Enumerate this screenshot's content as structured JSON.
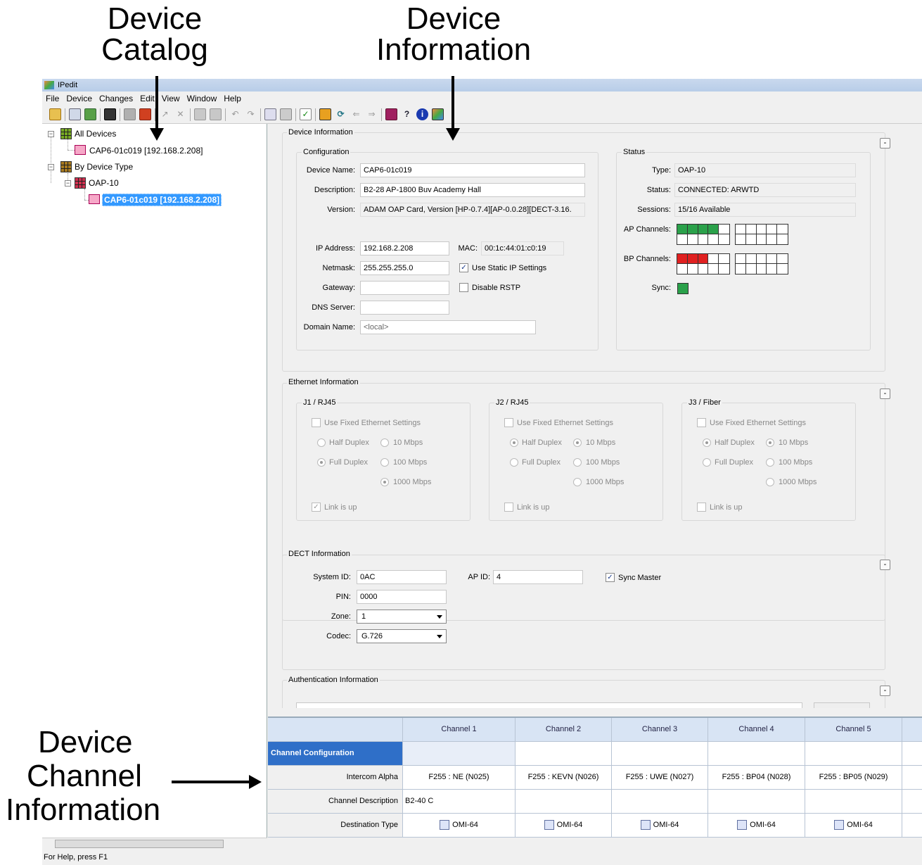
{
  "annotations": {
    "device_catalog": "Device\nCatalog",
    "device_catalog_l1": "Device",
    "device_catalog_l2": "Catalog",
    "device_information_l1": "Device",
    "device_information_l2": "Information",
    "device_channel_l1": "Device",
    "device_channel_l2": "Channel",
    "device_channel_l3": "Information"
  },
  "window": {
    "title": "IPedit"
  },
  "menu": [
    "File",
    "Device",
    "Changes",
    "Edit",
    "View",
    "Window",
    "Help"
  ],
  "tree": {
    "all_devices": "All Devices",
    "all_devices_child": "CAP6-01c019 [192.168.2.208]",
    "by_type": "By Device Type",
    "type_node": "OAP-10",
    "selected": "CAP6-01c019 [192.168.2.208]"
  },
  "device_info": {
    "group_title": "Device Information",
    "configuration": {
      "title": "Configuration",
      "device_name_label": "Device Name:",
      "device_name": "CAP6-01c019",
      "description_label": "Description:",
      "description": "B2-28 AP-1800 Buv Academy Hall",
      "version_label": "Version:",
      "version": "ADAM OAP Card, Version [HP-0.7.4][AP-0.0.28][DECT-3.16.",
      "ip_label": "IP Address:",
      "ip": "192.168.2.208",
      "mac_label": "MAC:",
      "mac": "00:1c:44:01:c0:19",
      "netmask_label": "Netmask:",
      "netmask": "255.255.255.0",
      "use_static_label": "Use Static IP Settings",
      "use_static_checked": true,
      "gateway_label": "Gateway:",
      "gateway": "",
      "disable_rstp_label": "Disable RSTP",
      "disable_rstp_checked": false,
      "dns_label": "DNS Server:",
      "dns": "",
      "domain_label": "Domain Name:",
      "domain_placeholder": "<local>"
    },
    "status": {
      "title": "Status",
      "type_label": "Type:",
      "type": "OAP-10",
      "status_label": "Status:",
      "status": "CONNECTED: ARWTD",
      "sessions_label": "Sessions:",
      "sessions": "15/16 Available",
      "ap_channels_label": "AP Channels:",
      "bp_channels_label": "BP Channels:",
      "sync_label": "Sync:",
      "ap_active": 4,
      "bp_active": 3,
      "colors": {
        "ap": "#2aa14a",
        "bp": "#e02020",
        "sync": "#2aa14a"
      }
    }
  },
  "ethernet": {
    "group_title": "Ethernet Information",
    "ports": [
      {
        "title": "J1 / RJ45",
        "fixed_label": "Use Fixed Ethernet Settings",
        "half": "Half Duplex",
        "full": "Full Duplex",
        "s10": "10 Mbps",
        "s100": "100 Mbps",
        "s1000": "1000 Mbps",
        "link": "Link is up",
        "link_checked": true,
        "duplex": "full",
        "speed": "1000"
      },
      {
        "title": "J2 / RJ45",
        "fixed_label": "Use Fixed Ethernet Settings",
        "half": "Half Duplex",
        "full": "Full Duplex",
        "s10": "10 Mbps",
        "s100": "100 Mbps",
        "s1000": "1000 Mbps",
        "link": "Link is up",
        "link_checked": false,
        "duplex": "half",
        "speed": "10"
      },
      {
        "title": "J3 / Fiber",
        "fixed_label": "Use Fixed Ethernet Settings",
        "half": "Half Duplex",
        "full": "Full Duplex",
        "s10": "10 Mbps",
        "s100": "100 Mbps",
        "s1000": "1000 Mbps",
        "link": "Link is up",
        "link_checked": false,
        "duplex": "half",
        "speed": "10"
      }
    ]
  },
  "dect": {
    "group_title": "DECT Information",
    "system_id_label": "System ID:",
    "system_id": "0AC",
    "ap_id_label": "AP ID:",
    "ap_id": "4",
    "sync_master_label": "Sync Master",
    "sync_master_checked": true,
    "pin_label": "PIN:",
    "pin": "0000",
    "zone_label": "Zone:",
    "zone": "1",
    "codec_label": "Codec:",
    "codec": "G.726"
  },
  "auth": {
    "group_title": "Authentication Information"
  },
  "channels": {
    "headers": [
      "Channel 1",
      "Channel 2",
      "Channel 3",
      "Channel 4",
      "Channel 5"
    ],
    "section": "Channel Configuration",
    "rows": [
      {
        "label": "Intercom Alpha",
        "values": [
          "F255 : NE (N025)",
          "F255 : KEVN (N026)",
          "F255 : UWE (N027)",
          "F255 : BP04 (N028)",
          "F255 : BP05 (N029)"
        ]
      },
      {
        "label": "Channel Description",
        "values": [
          "B2-40 C",
          "",
          "",
          "",
          ""
        ]
      },
      {
        "label": "Destination Type",
        "values": [
          "OMI-64",
          "OMI-64",
          "OMI-64",
          "OMI-64",
          "OMI-64"
        ]
      }
    ]
  },
  "statusbar": "For Help, press F1"
}
